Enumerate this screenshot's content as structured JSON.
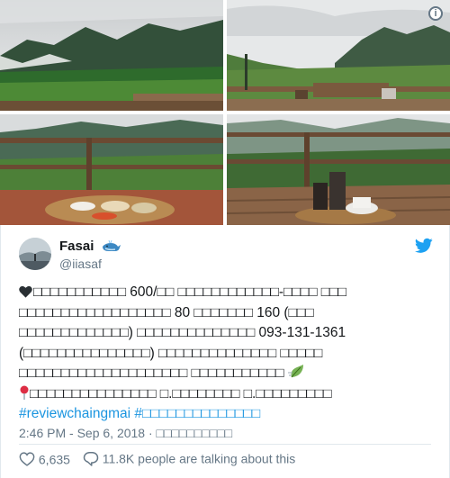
{
  "tweet": {
    "author": {
      "display_name": "Fasai",
      "handle": "@iiasaf"
    },
    "text_lines": [
      "□□□□□□□□□□□ 600/□□ □□□□□□□□□□□□-□□□□ □□□",
      "□□□□□□□□□□□□□□□□□□ 80 □□□□□□□ 160 (□□□",
      "□□□□□□□□□□□□□) □□□□□□□□□□□□□□ 093-131-1361",
      "(□□□□□□□□□□□□□□□) □□□□□□□□□□□□□□ □□□□□",
      "□□□□□□□□□□□□□□□□□□□□ □□□□□□□□□□□",
      "□□□□□□□□□□□□□□□  □.□□□□□□□□ □.□□□□□□□□□"
    ],
    "hashtag_1": "#reviewchaingmai",
    "hashtag_2": "#□□□□□□□□□□□□□□",
    "timestamp": "2:46 PM - Sep 6, 2018 · □□□□□□□□□□",
    "likes": "6,635",
    "conversation": "11.8K people are talking about this"
  },
  "icons": {
    "info": "info-icon",
    "verified_emoji": "whale-emoji",
    "brand": "twitter-bird-icon",
    "like": "heart-outline-icon",
    "reply": "speech-bubble-icon",
    "heart_emoji": "black-heart-emoji",
    "leaf_emoji": "leaf-wind-emoji",
    "pin_emoji": "round-pushpin-emoji"
  },
  "colors": {
    "link": "#1b95e0",
    "text": "#14171a",
    "muted": "#657786",
    "twitter_blue": "#1da1f2",
    "border": "#e1e8ed"
  }
}
